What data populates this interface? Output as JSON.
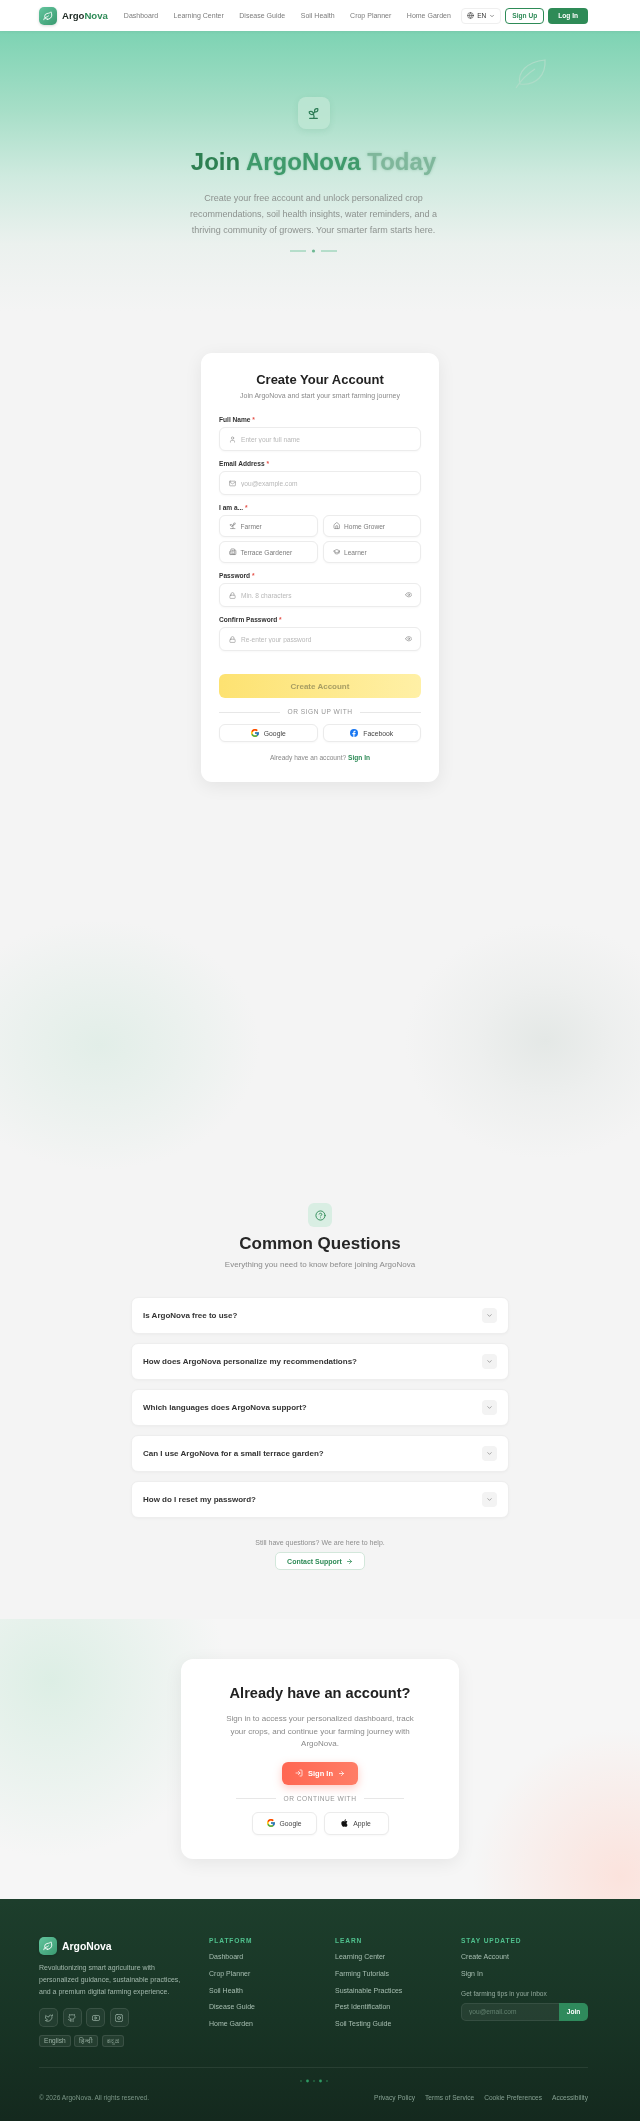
{
  "header": {
    "brand": [
      "Argo",
      "Nova"
    ],
    "nav": [
      "Dashboard",
      "Learning Center",
      "Disease Guide",
      "Soil Health",
      "Crop Planner",
      "Home Garden"
    ],
    "language": "EN",
    "sign_up": "Sign Up",
    "log_in": "Log In"
  },
  "hero": {
    "title_words": [
      "Join",
      "ArgoNova",
      "Today"
    ],
    "description": "Create your free account and unlock personalized crop recommendations, soil health insights, water reminders, and a thriving community of growers. Your smarter farm starts here."
  },
  "signup": {
    "title": "Create Your Account",
    "subtitle": "Join ArgoNova and start your smart farming journey",
    "fields": [
      {
        "kind": "name",
        "label": "Full Name",
        "required_mark": "*",
        "placeholder": "Enter your full name"
      },
      {
        "kind": "email",
        "label": "Email Address",
        "required_mark": "*",
        "placeholder": "you@example.com"
      },
      {
        "kind": "roles",
        "label": "I am a...",
        "required_mark": "*",
        "options": [
          {
            "label": "Farmer",
            "selected": false
          },
          {
            "label": "Home Grower",
            "selected": false
          },
          {
            "label": "Terrace Gardener",
            "selected": false
          },
          {
            "label": "Learner",
            "selected": false
          }
        ]
      },
      {
        "kind": "password",
        "label": "Password",
        "required_mark": "*",
        "placeholder": "Min. 8 characters"
      },
      {
        "kind": "password",
        "label": "Confirm Password",
        "required_mark": "*",
        "placeholder": "Re-enter your password"
      }
    ],
    "submit": {
      "label": "Create Account",
      "disabled": true
    },
    "divider": "OR SIGN UP WITH",
    "providers": [
      {
        "kind": "google",
        "label": "Google"
      },
      {
        "kind": "facebook",
        "label": "Facebook"
      }
    ],
    "prompt": "Already have an account?",
    "prompt_link": "Sign In"
  },
  "faq": {
    "title": "Common Questions",
    "subtitle": "Everything you need to know before joining ArgoNova",
    "items": [
      {
        "question": "Is ArgoNova free to use?",
        "expanded": false
      },
      {
        "question": "How does ArgoNova personalize my recommendations?",
        "expanded": false
      },
      {
        "question": "Which languages does ArgoNova support?",
        "expanded": false
      },
      {
        "question": "Can I use ArgoNova for a small terrace garden?",
        "expanded": false
      },
      {
        "question": "How do I reset my password?",
        "expanded": false
      }
    ],
    "help_text": "Still have questions? We are here to help.",
    "contact_button": "Contact Support"
  },
  "signin": {
    "title": "Already have an account?",
    "description": "Sign in to access your personalized dashboard, track your crops, and continue your farming journey with ArgoNova.",
    "button": "Sign In",
    "divider": "OR CONTINUE WITH",
    "providers": [
      {
        "kind": "google",
        "label": "Google"
      },
      {
        "kind": "apple",
        "label": "Apple"
      }
    ]
  },
  "footer": {
    "brand": "ArgoNova",
    "description": "Revolutionizing smart agriculture with personalized guidance, sustainable practices, and a premium digital farming experience.",
    "languages": [
      "English",
      "हिन्दी",
      "ಕನ್ನಡ"
    ],
    "columns": [
      {
        "heading": "PLATFORM",
        "links": [
          "Dashboard",
          "Crop Planner",
          "Soil Health",
          "Disease Guide",
          "Home Garden"
        ]
      },
      {
        "heading": "LEARN",
        "links": [
          "Learning Center",
          "Farming Tutorials",
          "Sustainable Practices",
          "Pest Identification",
          "Soil Testing Guide"
        ]
      }
    ],
    "newsletter": {
      "heading": "STAY UPDATED",
      "links": [
        "Create Account",
        "Sign In"
      ],
      "prompt": "Get farming tips in your inbox",
      "placeholder": "you@email.com",
      "button": "Join"
    },
    "copyright": "© 2026 ArgoNova. All rights reserved.",
    "legal_links": [
      "Privacy Policy",
      "Terms of Service",
      "Cookie Preferences",
      "Accessibility"
    ]
  }
}
